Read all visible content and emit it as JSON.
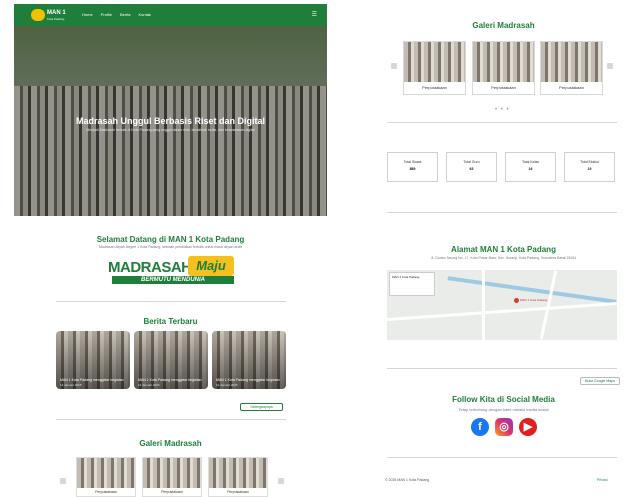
{
  "brand": {
    "logo_text": "MAN 1",
    "logo_sub": "Kota Padang",
    "accent": "#1e7e3a",
    "gold": "#f4c01f"
  },
  "nav": {
    "items": [
      "Home",
      "Profile",
      "Berita",
      "Kontak"
    ],
    "menu_icon": "menu-icon"
  },
  "hero": {
    "title": "Madrasah Unggul Berbasis Riset dan Digital",
    "subtitle": "Menjadi Madrasah terbaik di Kota Padang yang unggul dalam riset, berakhlak mulia, dan berwawasan digital"
  },
  "welcome": {
    "title": "Selamat Datang di MAN 1 Kota Padang",
    "subtitle": "Madrasah Aliyah Negeri 1 Kota Padang, sekolah pendidikan terbaik untuk masa depan anak"
  },
  "motto_logo": {
    "word1": "MADRASAH",
    "word2": "Maju",
    "tagline": "BERMUTU MENDUNIA"
  },
  "berita": {
    "title": "Berita Terbaru",
    "cards": [
      {
        "caption": "MAN 1 Kota Padang menggelar kegiatan",
        "date": "12 Januari 2025"
      },
      {
        "caption": "MAN 1 Kota Padang menggelar kegiatan",
        "date": "12 Januari 2025"
      },
      {
        "caption": "MAN 1 Kota Padang menggelar kegiatan",
        "date": "12 Januari 2025"
      }
    ],
    "more_label": "Selengkapnya"
  },
  "galeri": {
    "title": "Galeri Madrasah",
    "items": [
      "Perpustakaan",
      "Perpustakaan",
      "Perpustakaan"
    ],
    "dots": "• • •"
  },
  "stats": [
    {
      "label": "Total Siswa",
      "value": "889"
    },
    {
      "label": "Total Guru",
      "value": "63"
    },
    {
      "label": "Total Kelas",
      "value": "16"
    },
    {
      "label": "Total Ekskul",
      "value": "19"
    }
  ],
  "alamat": {
    "title": "Alamat MAN 1 Kota Padang",
    "subtitle": "Jl. Durian Tarung No. 17, Koto Pasar Baru, Kec. Kuranji, Kota Padang, Sumatera Barat 25151",
    "map_infobox": "MAN 1 Kota Padang",
    "map_pin": "MAN 1 Kota Padang",
    "gmaps_label": "Buka Google Maps"
  },
  "follow": {
    "title": "Follow Kita di Social Media",
    "subtitle": "Tetap terhubung dengan kami melalui media sosial"
  },
  "footer": {
    "text": "© 2025 MAN 1 Kota Padang",
    "link": "Privasi"
  }
}
